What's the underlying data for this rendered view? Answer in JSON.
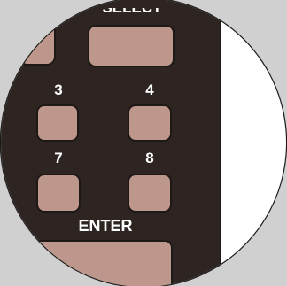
{
  "remote": {
    "top_button_label": "SELECT",
    "row1": [
      "3",
      "4"
    ],
    "row2": [
      "7",
      "8"
    ],
    "enter_label": "ENTER"
  },
  "colors": {
    "remote_body": "#2e2522",
    "button_fill": "#bd978c",
    "label_text": "#ffffff",
    "backdrop": "#d0d0d0",
    "background": "#ffffff"
  }
}
